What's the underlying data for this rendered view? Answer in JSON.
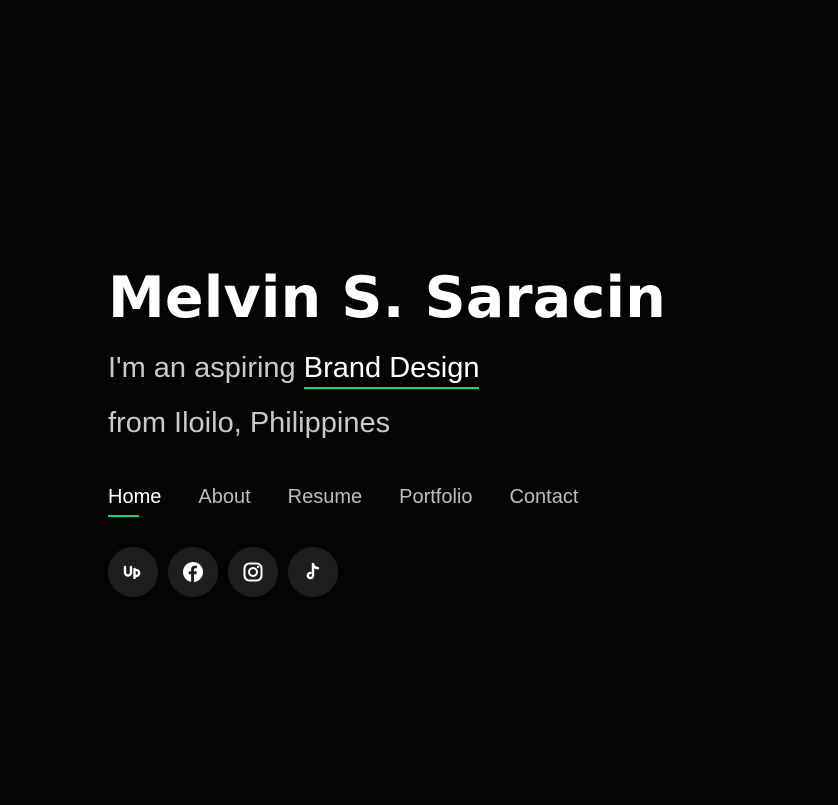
{
  "hero": {
    "name": "Melvin S. Saracin",
    "tagline_prefix": "I'm an aspiring",
    "tagline_role": "Brand Design",
    "location": "from Iloilo, Philippines"
  },
  "nav": {
    "items": [
      {
        "label": "Home",
        "active": true
      },
      {
        "label": "About",
        "active": false
      },
      {
        "label": "Resume",
        "active": false
      },
      {
        "label": "Portfolio",
        "active": false
      },
      {
        "label": "Contact",
        "active": false
      }
    ]
  },
  "social": {
    "links": [
      {
        "icon": "upwork-icon"
      },
      {
        "icon": "facebook-icon"
      },
      {
        "icon": "instagram-icon"
      },
      {
        "icon": "tiktok-icon"
      }
    ]
  },
  "colors": {
    "background": "#040404",
    "accent": "#18d26e",
    "text": "#ffffff",
    "muted_text": "#c9c9c9",
    "icon_bg": "#1e1e1e"
  }
}
